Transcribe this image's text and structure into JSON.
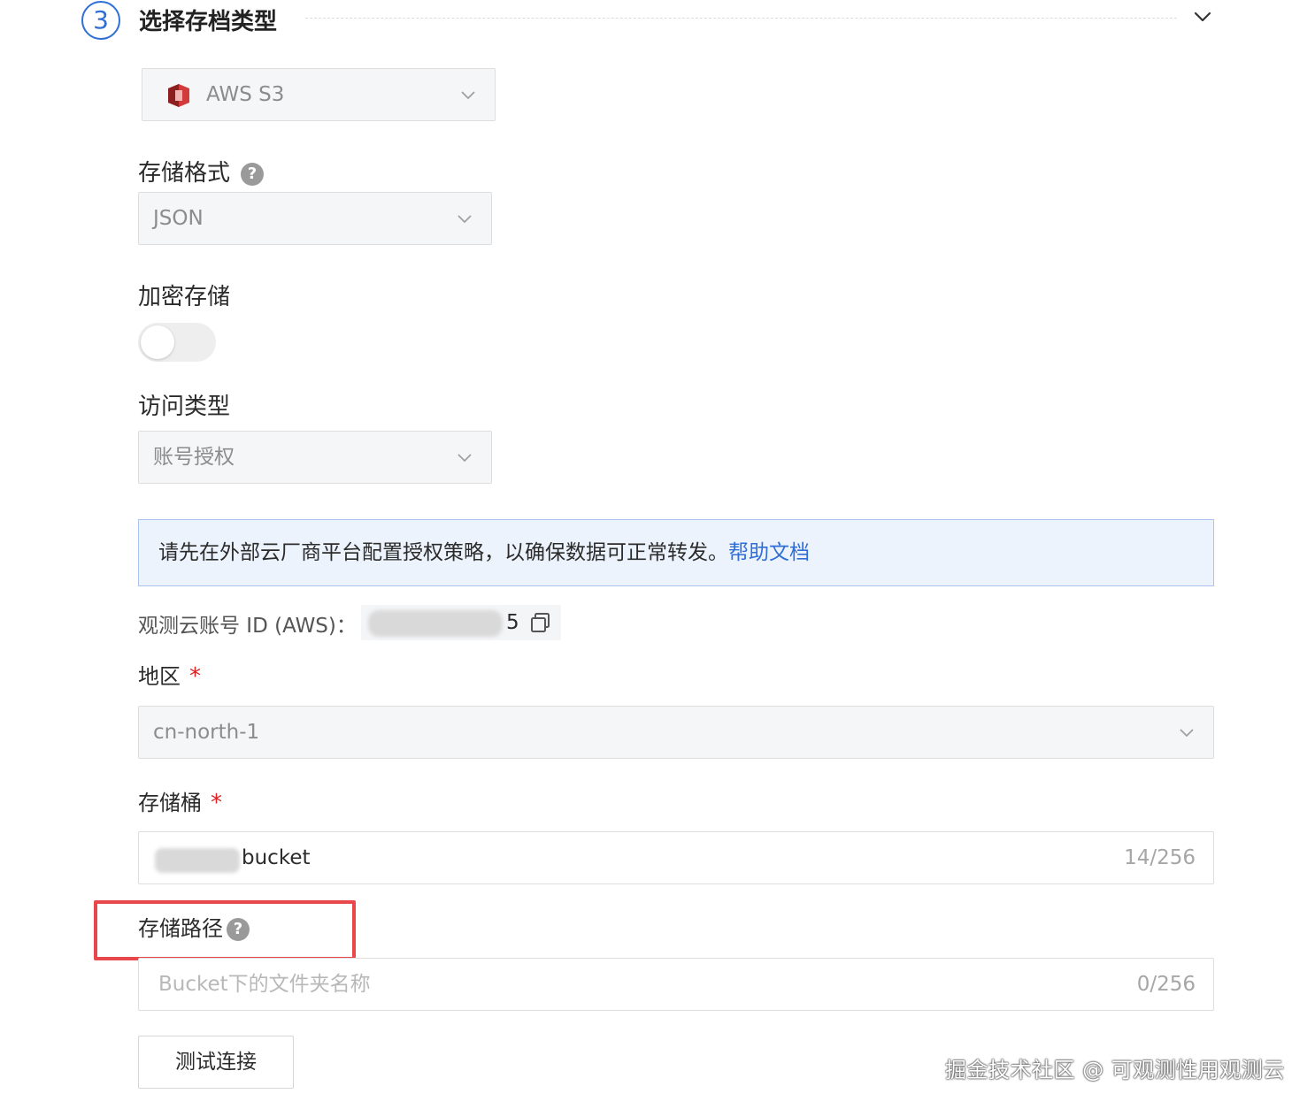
{
  "step": {
    "number": "3",
    "title": "选择存档类型"
  },
  "archive_type": {
    "value": "AWS S3",
    "icon": "aws-s3-icon"
  },
  "storage_format": {
    "label": "存储格式",
    "value": "JSON"
  },
  "encryption": {
    "label": "加密存储",
    "enabled": false
  },
  "access_type": {
    "label": "访问类型",
    "value": "账号授权"
  },
  "banner": {
    "text": "请先在外部云厂商平台配置授权策略，以确保数据可正常转发。",
    "link": "帮助文档"
  },
  "account_id": {
    "label": "观测云账号 ID (AWS)：",
    "value_visible": "5"
  },
  "region": {
    "label": "地区",
    "required_mark": "*",
    "value": "cn-north-1"
  },
  "bucket": {
    "label": "存储桶",
    "required_mark": "*",
    "value_visible": "bucket",
    "counter": "14/256"
  },
  "storage_path": {
    "label": "存储路径",
    "placeholder": "Bucket下的文件夹名称",
    "counter": "0/256"
  },
  "test_button": {
    "label": "测试连接"
  },
  "watermark": "掘金技术社区 @ 可观测性用观测云",
  "colors": {
    "accent": "#2f6fd6",
    "required": "#e02020",
    "highlight": "#e8474b",
    "banner_bg": "#edf3fd"
  }
}
